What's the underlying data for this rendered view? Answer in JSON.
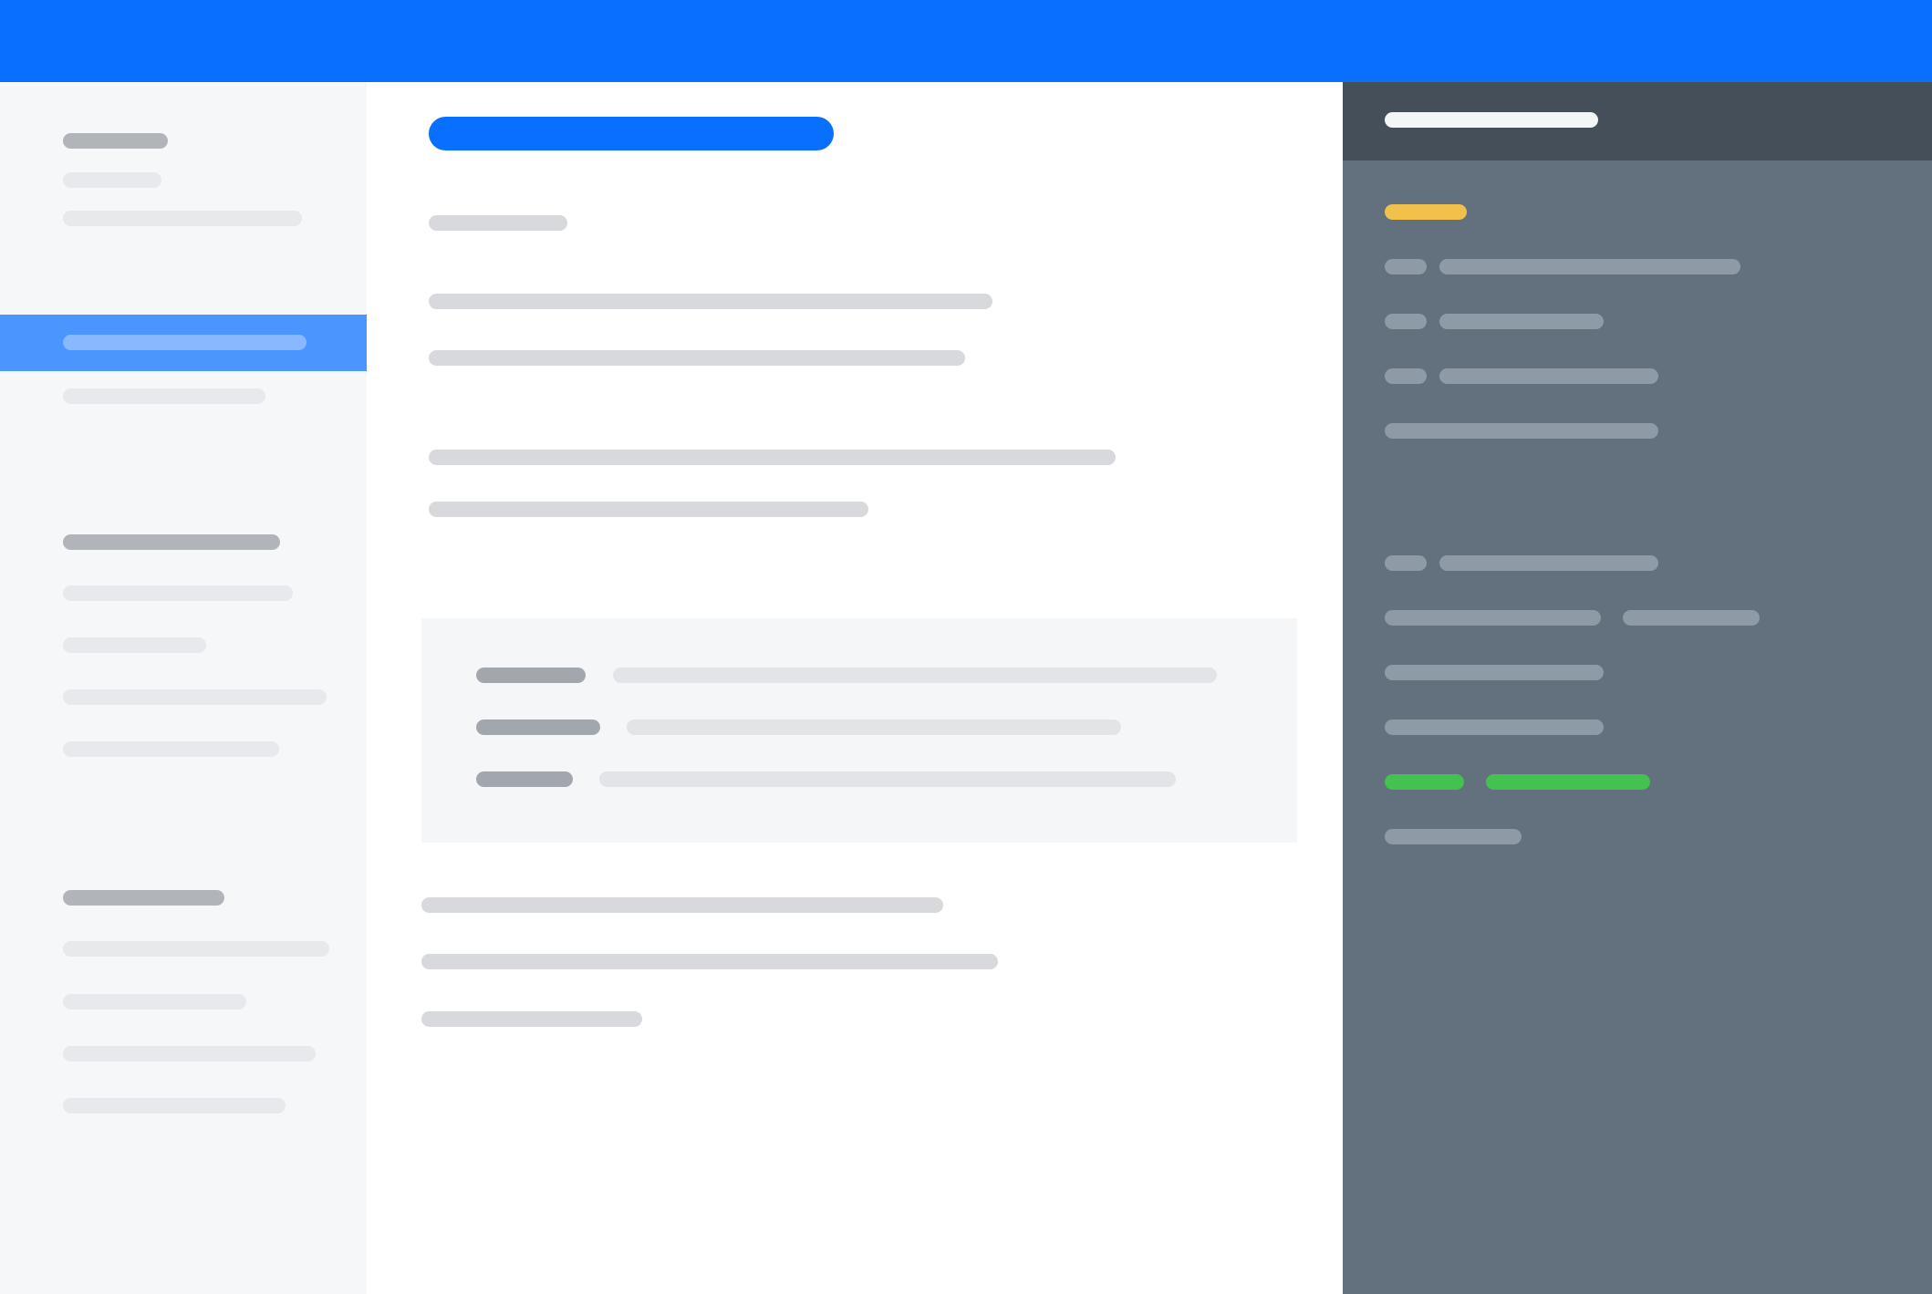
{
  "colors": {
    "accent": "#086ffe",
    "selected_row": "#4b95fe",
    "panel_background": "#63707d",
    "status_yellow": "#f2c14c",
    "status_green": "#43c151"
  },
  "topbar": {
    "title": ""
  },
  "sidebar": {
    "sections": [
      {
        "heading": "",
        "items": [
          {
            "label": "",
            "selected": false
          },
          {
            "label": "",
            "selected": false
          },
          {
            "label": "",
            "selected": true
          },
          {
            "label": "",
            "selected": false
          }
        ]
      },
      {
        "heading": "",
        "items": [
          {
            "label": "",
            "selected": false
          },
          {
            "label": "",
            "selected": false
          },
          {
            "label": "",
            "selected": false
          },
          {
            "label": "",
            "selected": false
          }
        ]
      },
      {
        "heading": "",
        "items": [
          {
            "label": "",
            "selected": false
          },
          {
            "label": "",
            "selected": false
          },
          {
            "label": "",
            "selected": false
          },
          {
            "label": "",
            "selected": false
          }
        ]
      }
    ]
  },
  "main": {
    "title": "",
    "subtitle": "",
    "paragraphs": [
      {
        "lines": [
          "",
          ""
        ]
      },
      {
        "lines": [
          "",
          ""
        ]
      }
    ],
    "infobox": {
      "rows": [
        {
          "key": "",
          "value": ""
        },
        {
          "key": "",
          "value": ""
        },
        {
          "key": "",
          "value": ""
        }
      ]
    },
    "footer_lines": [
      "",
      "",
      ""
    ]
  },
  "panel": {
    "title": "",
    "status_badge": "",
    "rows": [
      {
        "label": "",
        "value": ""
      },
      {
        "label": "",
        "value": ""
      },
      {
        "label": "",
        "value": ""
      },
      {
        "label": "",
        "value": ""
      },
      {
        "label": "",
        "value": ""
      },
      {
        "label": "",
        "value": ""
      },
      {
        "label": "",
        "value": ""
      },
      {
        "label": "",
        "value": ""
      },
      {
        "label": "",
        "value": ""
      },
      {
        "label": "",
        "value": ""
      }
    ]
  }
}
